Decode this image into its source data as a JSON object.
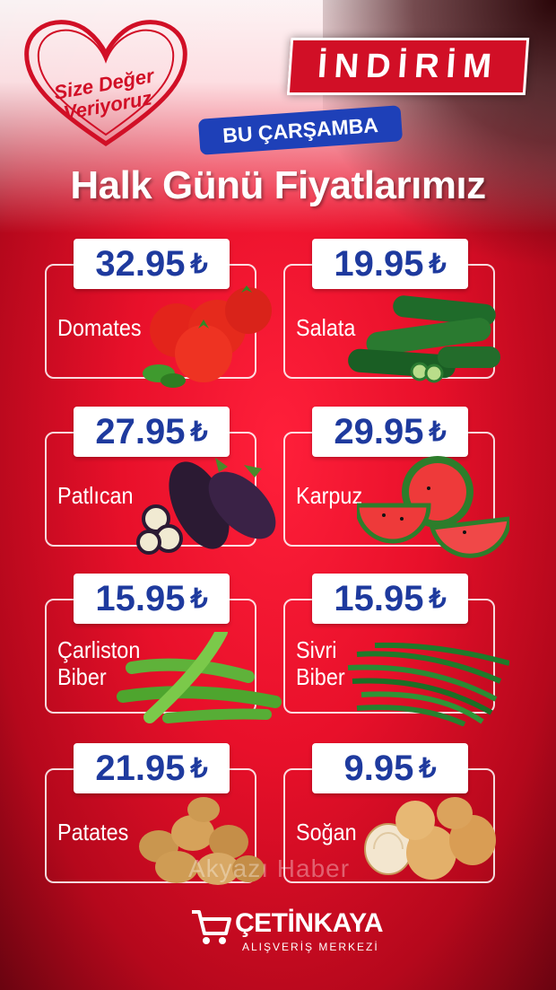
{
  "header": {
    "slogan": "Size Değer Veriyoruz",
    "badge": "İNDİRİM",
    "day": "BU ÇARŞAMBA",
    "title": "Halk Günü Fiyatlarımız"
  },
  "currency_symbol": "₺",
  "products": [
    {
      "name": "Domates",
      "price": "32.95"
    },
    {
      "name": "Salata",
      "price": "19.95"
    },
    {
      "name": "Patlıcan",
      "price": "27.95"
    },
    {
      "name": "Karpuz",
      "price": "29.95"
    },
    {
      "name": "Çarliston Biber",
      "price": "15.95"
    },
    {
      "name": "Sivri Biber",
      "price": "15.95"
    },
    {
      "name": "Patates",
      "price": "21.95"
    },
    {
      "name": "Soğan",
      "price": "9.95"
    }
  ],
  "footer": {
    "brand": "ÇETİNKAYA",
    "subtitle": "ALIŞVERİŞ MERKEZİ",
    "watermark": "Akyazı Haber"
  },
  "colors": {
    "primary_red": "#d10f26",
    "price_blue": "#1e3a9e",
    "day_badge_blue": "#1e40b8"
  },
  "icons": [
    "heart-outline-icon",
    "shopping-cart-icon"
  ]
}
